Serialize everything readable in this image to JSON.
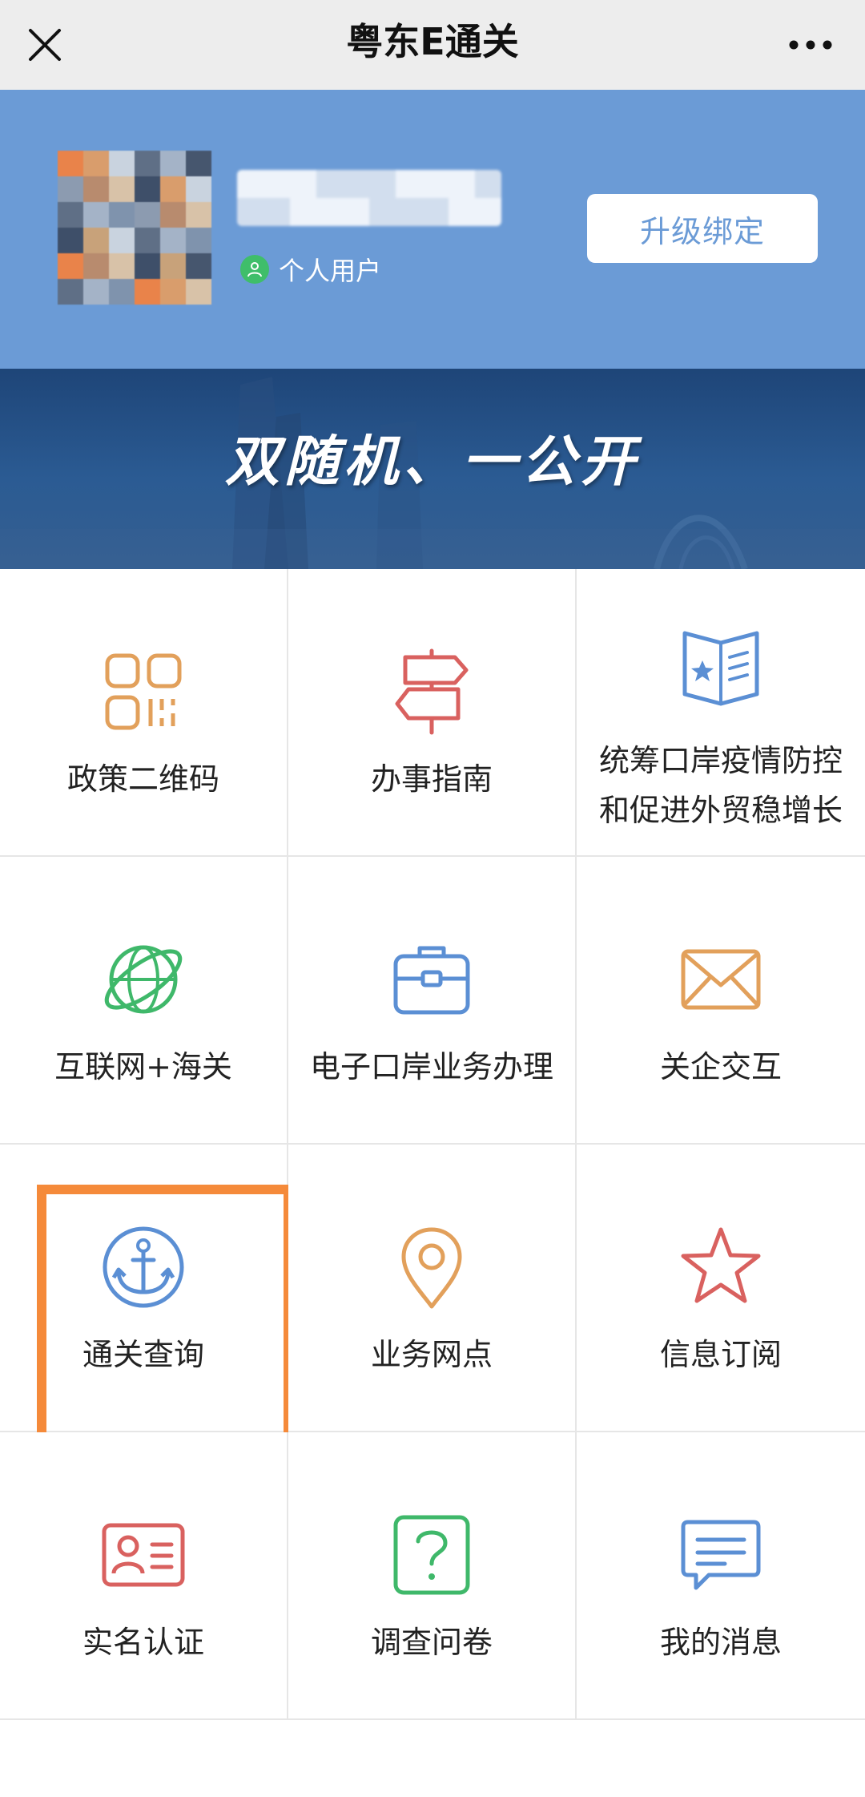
{
  "app": {
    "title": "粤东E通关"
  },
  "profile": {
    "user_type": "个人用户",
    "upgrade_button": "升级绑定"
  },
  "banner": {
    "slogan": "双随机、一公开"
  },
  "services": [
    {
      "label": "政策二维码",
      "icon": "qr-code-icon",
      "color": "#e2a05b"
    },
    {
      "label": "办事指南",
      "icon": "signpost-icon",
      "color": "#d9615f"
    },
    {
      "label": "统筹口岸疫情防控和促进外贸稳增长",
      "icon": "open-book-star-icon",
      "color": "#5b8fd4"
    },
    {
      "label": "互联网+海关",
      "icon": "globe-orbit-icon",
      "color": "#3fb86a"
    },
    {
      "label": "电子口岸业务办理",
      "icon": "briefcase-icon",
      "color": "#5b8fd4"
    },
    {
      "label": "关企交互",
      "icon": "envelope-icon",
      "color": "#e2a05b"
    },
    {
      "label": "通关查询",
      "icon": "anchor-icon",
      "color": "#5b8fd4"
    },
    {
      "label": "业务网点",
      "icon": "map-pin-icon",
      "color": "#e2a05b"
    },
    {
      "label": "信息订阅",
      "icon": "star-icon",
      "color": "#d9615f"
    },
    {
      "label": "实名认证",
      "icon": "id-card-icon",
      "color": "#d9615f"
    },
    {
      "label": "调查问卷",
      "icon": "question-box-icon",
      "color": "#3fb86a"
    },
    {
      "label": "我的消息",
      "icon": "chat-bubble-icon",
      "color": "#5b8fd4"
    }
  ],
  "colors": {
    "profile_bg": "#6b9bd6",
    "highlight_frame": "#f58a3a"
  }
}
